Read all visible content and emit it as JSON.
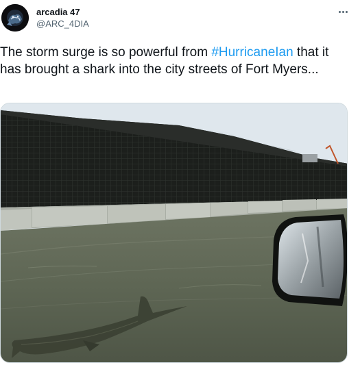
{
  "author": {
    "display_name": "arcadia 47",
    "handle": "@ARC_4DIA"
  },
  "tweet": {
    "text_before": "The storm surge is so powerful from ",
    "hashtag": "#HurricaneIan",
    "text_after": " that it has brought a shark into the city streets of Fort Myers..."
  },
  "icons": {
    "more": "more-options-icon"
  },
  "colors": {
    "hashtag": "#1d9bf0",
    "handle": "#536471",
    "text": "#0f1419"
  }
}
